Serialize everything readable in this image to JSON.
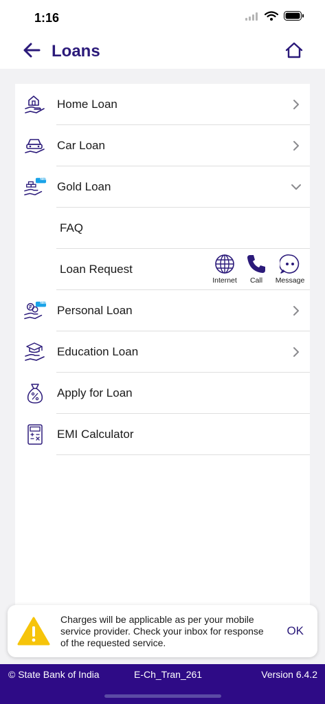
{
  "status": {
    "time": "1:16"
  },
  "nav": {
    "title": "Loans"
  },
  "menu": {
    "home_loan": "Home Loan",
    "car_loan": "Car Loan",
    "gold_loan": "Gold Loan",
    "faq": "FAQ",
    "loan_request": "Loan Request",
    "personal_loan": "Personal Loan",
    "education_loan": "Education Loan",
    "apply_for_loan": "Apply for Loan",
    "emi_calculator": "EMI Calculator"
  },
  "badges": {
    "new": "New"
  },
  "contact": {
    "internet": "Internet",
    "call": "Call",
    "message": "Message"
  },
  "toast": {
    "message": "Charges will be applicable as per your mobile service provider. Check your inbox for response of the requested service.",
    "ok": "OK"
  },
  "footer": {
    "copyright": "© State Bank of India",
    "code": "E-Ch_Tran_261",
    "version": "Version 6.4.2"
  },
  "colors": {
    "brand": "#2b1a7a",
    "footer_bg": "#2e0b86",
    "new_badge": "#1aa3e8",
    "warning": "#f6c40a"
  },
  "icons": {
    "status": [
      "cellular-icon",
      "wifi-icon",
      "battery-icon"
    ],
    "nav": [
      "back-arrow-icon",
      "home-icon"
    ],
    "rows": [
      "home-loan-icon",
      "car-loan-icon",
      "gold-loan-icon",
      "personal-loan-icon",
      "education-loan-icon",
      "apply-loan-icon",
      "emi-calculator-icon"
    ],
    "contact": [
      "globe-icon",
      "phone-icon",
      "message-bubble-icon"
    ],
    "toast": "warning-icon"
  }
}
